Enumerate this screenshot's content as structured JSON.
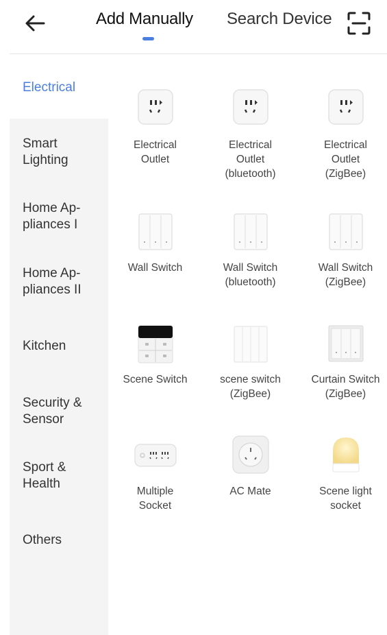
{
  "header": {
    "tabs": [
      {
        "label": "Add Manually",
        "active": true
      },
      {
        "label": "Search Device",
        "active": false
      }
    ],
    "icons": {
      "back": "arrow-left-icon",
      "scan": "scan-frame-icon"
    },
    "accent_color": "#4a7ee0"
  },
  "sidebar": {
    "items": [
      {
        "line1": "Electrical",
        "line2": "",
        "active": true
      },
      {
        "line1": "Smart",
        "line2": "Lighting",
        "active": false
      },
      {
        "line1": "Home Ap-",
        "line2": "pliances I",
        "active": false
      },
      {
        "line1": "Home Ap-",
        "line2": "pliances II",
        "active": false
      },
      {
        "line1": "Kitchen",
        "line2": "",
        "active": false
      },
      {
        "line1": "Security &",
        "line2": "Sensor",
        "active": false
      },
      {
        "line1": "Sport &",
        "line2": "Health",
        "active": false
      },
      {
        "line1": "Others",
        "line2": "",
        "active": false
      }
    ]
  },
  "devices": [
    {
      "lines": [
        "Electrical",
        "Outlet",
        ""
      ],
      "icon": "outlet-icon"
    },
    {
      "lines": [
        "Electrical",
        "Outlet",
        "(bluetooth)"
      ],
      "icon": "outlet-icon"
    },
    {
      "lines": [
        "Electrical",
        "Outlet",
        "(ZigBee)"
      ],
      "icon": "outlet-icon"
    },
    {
      "lines": [
        "Wall Switch",
        "",
        ""
      ],
      "icon": "wall-switch-icon"
    },
    {
      "lines": [
        "Wall Switch",
        "(bluetooth)",
        ""
      ],
      "icon": "wall-switch-icon"
    },
    {
      "lines": [
        "Wall Switch",
        "(ZigBee)",
        ""
      ],
      "icon": "wall-switch-icon"
    },
    {
      "lines": [
        "Scene Switch",
        "",
        ""
      ],
      "icon": "scene-switch-icon"
    },
    {
      "lines": [
        "scene switch",
        "(ZigBee)",
        ""
      ],
      "icon": "scene-switch-zigbee-icon"
    },
    {
      "lines": [
        "Curtain Switch",
        "(ZigBee)",
        ""
      ],
      "icon": "curtain-switch-icon"
    },
    {
      "lines": [
        "Multiple",
        "Socket",
        ""
      ],
      "icon": "power-strip-icon"
    },
    {
      "lines": [
        "AC Mate",
        "",
        ""
      ],
      "icon": "ac-mate-icon"
    },
    {
      "lines": [
        "Scene light",
        "socket",
        ""
      ],
      "icon": "scene-light-socket-icon"
    }
  ]
}
